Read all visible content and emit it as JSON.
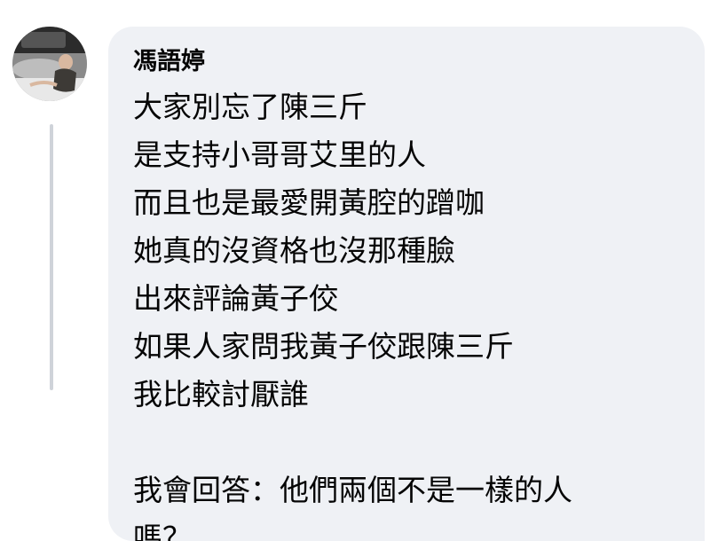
{
  "comment": {
    "author": "馮語婷",
    "lines": [
      "大家別忘了陳三斤",
      "是支持小哥哥艾里的人",
      "而且也是最愛開黃腔的蹭咖",
      "她真的沒資格也沒那種臉",
      "出來評論黃子佼",
      "如果人家問我黃子佼跟陳三斤",
      "我比較討厭誰",
      "",
      "我會回答：他們兩個不是一樣的人",
      "嗎？"
    ]
  },
  "colors": {
    "bubble": "#eff1f5",
    "text": "#050505",
    "thread_line": "#cfd3d9"
  }
}
